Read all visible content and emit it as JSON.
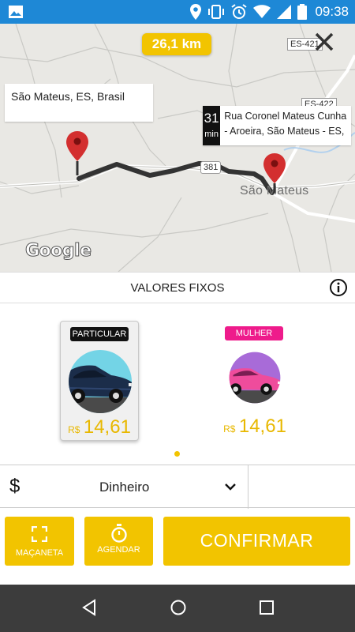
{
  "status_bar": {
    "time": "09:38",
    "icons": [
      "image-icon",
      "location-icon",
      "vibrate-icon",
      "alarm-icon",
      "wifi-icon",
      "signal-icon",
      "battery-icon"
    ],
    "color": "#1e88d6"
  },
  "map": {
    "distance": "26,1 km",
    "origin_address": "São Mateus, ES, Brasil",
    "eta_value": "31",
    "eta_unit": "min",
    "destination_address": "Rua Coronel Mateus Cunha - Aroeira, São Mateus - ES,",
    "city_label": "São Mateus",
    "road_labels": [
      "ES-421",
      "ES-422",
      "381"
    ],
    "provider_logo": "Google",
    "pin_color": "#d32f2f",
    "route_color": "#333333"
  },
  "pricing": {
    "title": "VALORES FIXOS",
    "cards": [
      {
        "tag": "PARTICULAR",
        "tag_color": "#111111",
        "currency": "R$",
        "price": "14,61",
        "selected": true
      },
      {
        "tag": "MULHER",
        "tag_color": "#ee1b8b",
        "currency": "R$",
        "price": "14,61",
        "selected": false
      }
    ]
  },
  "payment": {
    "icon": "$",
    "method": "Dinheiro"
  },
  "actions": {
    "macaneta": "MAÇANETA",
    "agendar": "AGENDAR",
    "confirmar": "CONFIRMAR",
    "accent": "#f2c400"
  }
}
